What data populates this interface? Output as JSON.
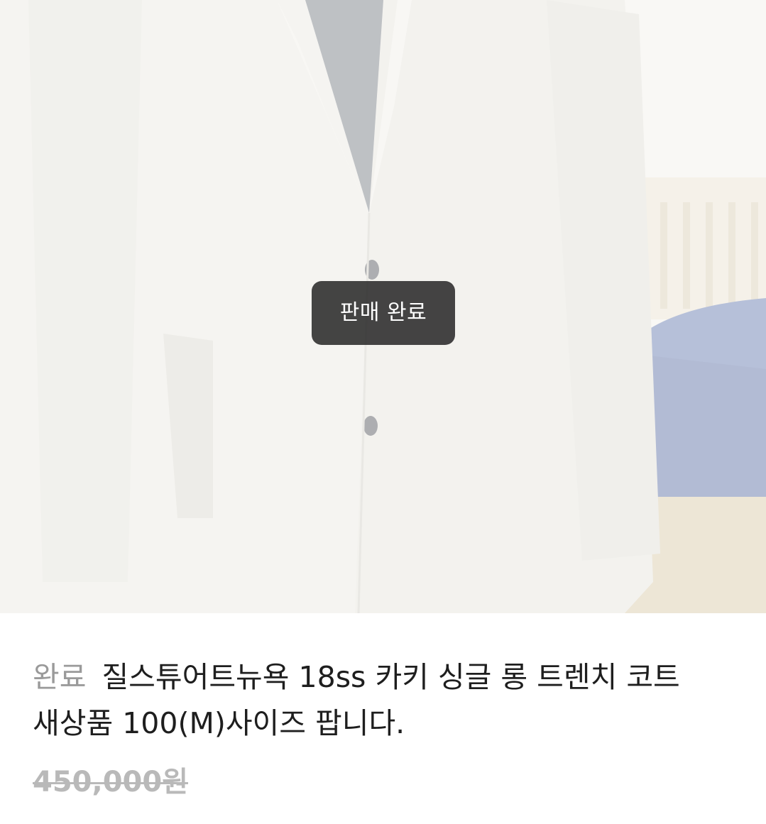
{
  "listing": {
    "status_overlay": "판매 완료",
    "status_tag": "완료",
    "title": "질스튜어트뉴욕 18ss 카키 싱글 롱 트렌치 코트 새상품 100(M)사이즈 팝니다.",
    "price": "450,000원",
    "price_struck": true
  },
  "photo": {
    "subject": "product-photo-coat",
    "colors": {
      "coat": "#e6e4dc",
      "wall": "#ecebe8",
      "bed_blanket": "#5d72a8",
      "bed_frame": "#d9cbb0"
    }
  }
}
